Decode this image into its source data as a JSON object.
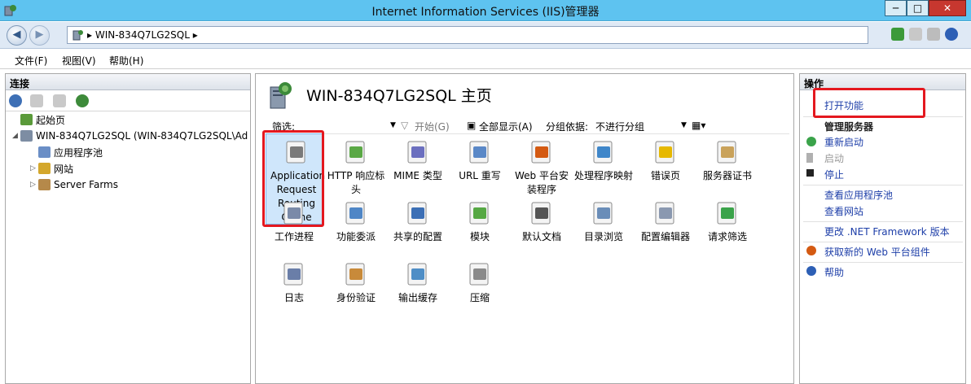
{
  "window": {
    "title": "Internet Information Services (IIS)管理器",
    "min": "─",
    "max": "□",
    "close": "✕"
  },
  "address": {
    "path": "▸  WIN-834Q7LG2SQL  ▸"
  },
  "menu": {
    "file": "文件(F)",
    "view": "视图(V)",
    "help": "帮助(H)"
  },
  "connections": {
    "title": "连接",
    "tree": [
      {
        "label": "起始页"
      },
      {
        "label": "WIN-834Q7LG2SQL (WIN-834Q7LG2SQL\\Ad"
      },
      {
        "label": "应用程序池"
      },
      {
        "label": "网站"
      },
      {
        "label": "Server Farms"
      }
    ]
  },
  "home": {
    "title": "WIN-834Q7LG2SQL 主页",
    "filter_label": "筛选:",
    "start": "开始(G)",
    "show_all": "全部显示(A)",
    "group_by": "分组依据:",
    "group_value": "不进行分组"
  },
  "features": [
    {
      "label": "Application Request Routing Cache",
      "color": "#7a7a7a"
    },
    {
      "label": "HTTP 响应标头",
      "color": "#5aa845"
    },
    {
      "label": "MIME 类型",
      "color": "#6b6fbf"
    },
    {
      "label": "URL 重写",
      "color": "#5a88c7"
    },
    {
      "label": "Web 平台安装程序",
      "color": "#d45a12"
    },
    {
      "label": "处理程序映射",
      "color": "#3f86c9"
    },
    {
      "label": "错误页",
      "color": "#e6b800"
    },
    {
      "label": "服务器证书",
      "color": "#c9a25a"
    },
    {
      "label": "工作进程",
      "color": "#7a8aa8"
    },
    {
      "label": "功能委派",
      "color": "#4f86c6"
    },
    {
      "label": "共享的配置",
      "color": "#3c6fb5"
    },
    {
      "label": "模块",
      "color": "#56a844"
    },
    {
      "label": "默认文档",
      "color": "#555555"
    },
    {
      "label": "目录浏览",
      "color": "#6a8db8"
    },
    {
      "label": "配置编辑器",
      "color": "#8a98b0"
    },
    {
      "label": "请求筛选",
      "color": "#3aa34a"
    },
    {
      "label": "日志",
      "color": "#6a7ea8"
    },
    {
      "label": "身份验证",
      "color": "#c88a3a"
    },
    {
      "label": "输出缓存",
      "color": "#4f8ec6"
    },
    {
      "label": "压缩",
      "color": "#8a8a8a"
    }
  ],
  "actions": {
    "title": "操作",
    "open_feature": "打开功能",
    "manage_server": "管理服务器",
    "restart": "重新启动",
    "start": "启动",
    "stop": "停止",
    "view_app_pools": "查看应用程序池",
    "view_sites": "查看网站",
    "change_net": "更改 .NET Framework 版本",
    "get_web_platform": "获取新的 Web 平台组件",
    "help": "帮助"
  }
}
